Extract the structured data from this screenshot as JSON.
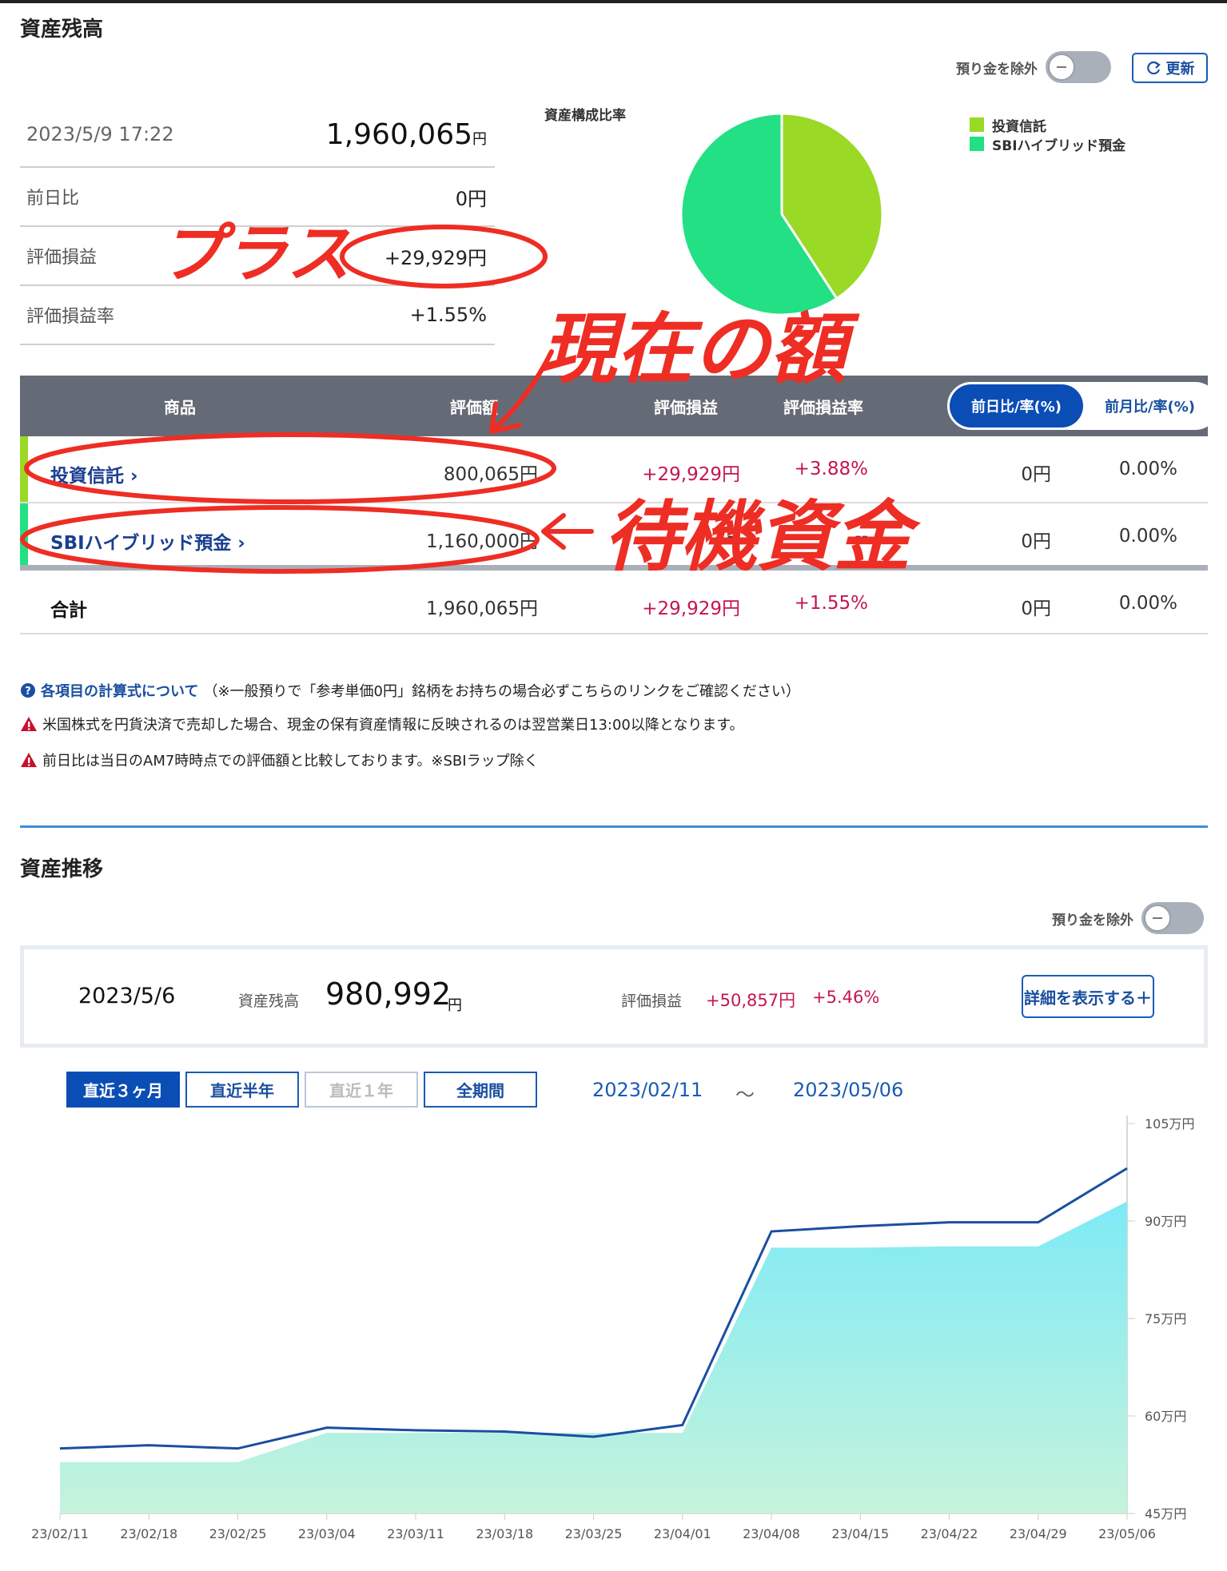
{
  "balance": {
    "title": "資産残高",
    "toggle_label": "預り金を除外",
    "refresh_label": "更新",
    "datetime": "2023/5/9 17:22",
    "total_value": "1,960,065",
    "yen": "円",
    "rows": [
      {
        "label": "前日比",
        "value": "0円"
      },
      {
        "label": "評価損益",
        "value": "+29,929円"
      },
      {
        "label": "評価損益率",
        "value": "+1.55%"
      }
    ]
  },
  "pie": {
    "title": "資産構成比率",
    "legend": [
      {
        "label": "投資信託",
        "color": "#9ad925",
        "value": 800065
      },
      {
        "label": "SBIハイブリッド預金",
        "color": "#22e083",
        "value": 1160000
      }
    ]
  },
  "table": {
    "headers": {
      "product": "商品",
      "valuation": "評価額",
      "gain": "評価損益",
      "gain_rate": "評価損益率"
    },
    "tabs": [
      "前日比/率(%)",
      "前月比/率(%)"
    ],
    "rows": [
      {
        "name": "投資信託 ›",
        "valuation": "800,065円",
        "gain": "+29,929円",
        "rate": "+3.88%",
        "day": "0円",
        "day_rate": "0.00%",
        "color": "#9ad925"
      },
      {
        "name": "SBIハイブリッド預金 ›",
        "valuation": "1,160,000円",
        "gain": "--",
        "rate": "--",
        "day": "0円",
        "day_rate": "0.00%",
        "color": "#22e083"
      }
    ],
    "total": {
      "name": "合計",
      "valuation": "1,960,065円",
      "gain": "+29,929円",
      "rate": "+1.55%",
      "day": "0円",
      "day_rate": "0.00%"
    }
  },
  "notes": {
    "n1_link": "各項目の計算式について",
    "n1_text": "（※一般預りで「参考単価0円」銘柄をお持ちの場合必ずこちらのリンクをご確認ください）",
    "n2": "米国株式を円貨決済で売却した場合、現金の保有資産情報に反映されるのは翌営業日13:00以降となります。",
    "n3": "前日比は当日のAM7時時点での評価額と比較しております。※SBIラップ除く"
  },
  "annotations": {
    "plus": "プラス",
    "current": "現在の額",
    "waiting": "待機資金"
  },
  "trend": {
    "title": "資産推移",
    "toggle_label": "預り金を除外",
    "date": "2023/5/6",
    "balance_label": "資産残高",
    "balance_value": "980,992",
    "yen": "円",
    "gain_label": "評価損益",
    "gain_value": "+50,857円",
    "gain_rate": "+5.46%",
    "detail_button": "詳細を表示する＋",
    "periods": [
      "直近３ヶ月",
      "直近半年",
      "直近１年",
      "全期間"
    ],
    "range_start": "2023/02/11",
    "range_sep": "～",
    "range_end": "2023/05/06"
  },
  "chart_data": {
    "type": "area",
    "x": [
      "23/02/11",
      "23/02/18",
      "23/02/25",
      "23/03/04",
      "23/03/11",
      "23/03/18",
      "23/03/25",
      "23/04/01",
      "23/04/08",
      "23/04/15",
      "23/04/22",
      "23/04/29",
      "23/05/06"
    ],
    "series": [
      {
        "name": "",
        "values": [
          55.0,
          55.5,
          55.0,
          58.2,
          57.8,
          57.6,
          56.8,
          58.6,
          88.4,
          89.2,
          89.8,
          89.8,
          98.1
        ],
        "color": "#1a4fa0",
        "style": "line"
      },
      {
        "name": "",
        "values": [
          52.9,
          52.9,
          52.9,
          57.4,
          57.4,
          57.4,
          57.4,
          57.4,
          85.9,
          85.9,
          86.1,
          86.1,
          93.0
        ],
        "color": "#7eeaf5",
        "style": "area"
      }
    ],
    "y_ticks": [
      "105万円",
      "90万円",
      "75万円",
      "60万円",
      "45万円"
    ],
    "ylim": [
      45,
      105
    ]
  }
}
